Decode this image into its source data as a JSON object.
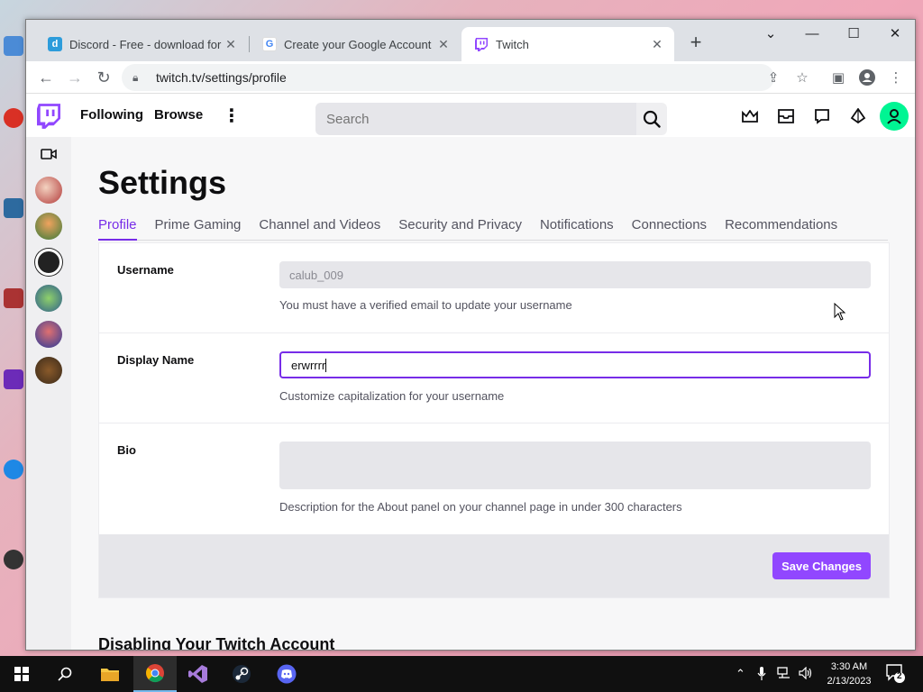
{
  "browser": {
    "tabs": [
      {
        "title": "Discord - Free - download for W",
        "favicon": "discord-icon",
        "close": "✕"
      },
      {
        "title": "Create your Google Account",
        "favicon": "google-icon",
        "close": "✕"
      },
      {
        "title": "Twitch",
        "favicon": "twitch-icon",
        "close": "✕",
        "active": true
      }
    ],
    "new_tab": "+",
    "url": "twitch.tv/settings/profile"
  },
  "twitch": {
    "nav": {
      "following": "Following",
      "browse": "Browse",
      "search_placeholder": "Search"
    },
    "settings": {
      "title": "Settings",
      "tabs": [
        "Profile",
        "Prime Gaming",
        "Channel and Videos",
        "Security and Privacy",
        "Notifications",
        "Connections",
        "Recommendations"
      ],
      "active_tab": "Profile",
      "username": {
        "label": "Username",
        "value": "calub_009",
        "help": "You must have a verified email to update your username"
      },
      "display_name": {
        "label": "Display Name",
        "value": "erwrrrr",
        "help": "Customize capitalization for your username"
      },
      "bio": {
        "label": "Bio",
        "value": "",
        "help": "Description for the About panel on your channel page in under 300 characters"
      },
      "save_label": "Save Changes",
      "disable_heading": "Disabling Your Twitch Account"
    }
  },
  "taskbar": {
    "time": "3:30 AM",
    "date": "2/13/2023",
    "notifications_count": "2"
  },
  "colors": {
    "twitch_purple": "#9147ff",
    "accent": "#772ce8",
    "avatar_green": "#00f593"
  }
}
